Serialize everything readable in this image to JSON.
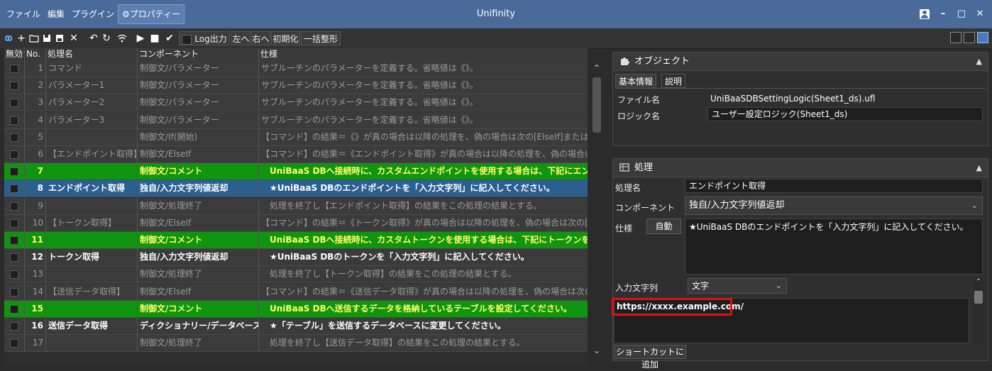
{
  "window": {
    "title": "Unifinity"
  },
  "menu": [
    {
      "label": "ファイル"
    },
    {
      "label": "編集"
    },
    {
      "label": "プラグイン"
    },
    {
      "label": "⚙プロパティー",
      "active": true
    }
  ],
  "toolbar": {
    "log_output": "Log出力",
    "left": "左へ",
    "right": "右へ",
    "init": "初期化",
    "format_all": "一括整形"
  },
  "grid": {
    "headers": {
      "disabled": "無効",
      "no": "No.",
      "name": "処理名",
      "component": "コンポーネント",
      "spec": "仕様"
    },
    "rows": [
      {
        "no": "1",
        "name": "コマンド",
        "component": "制御文/パラメーター",
        "spec": "サブルーチンのパラメーターを定義する。省略値は《》。",
        "style": "dim"
      },
      {
        "no": "2",
        "name": "パラメーター1",
        "component": "制御文/パラメーター",
        "spec": "サブルーチンのパラメーターを定義する。省略値は《》。",
        "style": "dim"
      },
      {
        "no": "3",
        "name": "パラメーター2",
        "component": "制御文/パラメーター",
        "spec": "サブルーチンのパラメーターを定義する。省略値は《》。",
        "style": "dim"
      },
      {
        "no": "4",
        "name": "パラメーター3",
        "component": "制御文/パラメーター",
        "spec": "サブルーチンのパラメーターを定義する。省略値は《》。",
        "style": "dim"
      },
      {
        "no": "5",
        "name": "",
        "component": "制御文/If(開始)",
        "spec": "【コマンド】の結果＝《》が真の場合は以降の処理を、偽の場合は次の[ElseIf]または[Else]ま",
        "style": "dim"
      },
      {
        "no": "6",
        "name": "【エンドポイント取得】",
        "component": "制御文/ElseIf",
        "spec": "【コマンド】の結果＝《エンドポイント取得》が真の場合は以降の処理を、偽の場合は次の[E",
        "style": "dim"
      },
      {
        "no": "7",
        "name": "",
        "component": "制御文/コメント",
        "spec": "　UniBaaS DBへ接続時に、カスタムエンドポイントを使用する場合は、下記にエンドポイン",
        "style": "green"
      },
      {
        "no": "8",
        "name": "エンドポイント取得",
        "component": "独自/入力文字列値返却",
        "spec": "　★UniBaaS DBのエンドポイントを「入力文字列」に記入してください。",
        "style": "blue"
      },
      {
        "no": "9",
        "name": "",
        "component": "制御文/処理終了",
        "spec": "　処理を終了し【エンドポイント取得】の結果をこの処理の結果とする。",
        "style": "dim"
      },
      {
        "no": "10",
        "name": "【トークン取得】",
        "component": "制御文/ElseIf",
        "spec": "【コマンド】の結果＝《トークン取得》が真の場合は以降の処理を、偽の場合は次の[ElseIf]ま",
        "style": "dim"
      },
      {
        "no": "11",
        "name": "",
        "component": "制御文/コメント",
        "spec": "　UniBaaS DBへ接続時に、カスタムトークンを使用する場合は、下記にトークンを設定して",
        "style": "green"
      },
      {
        "no": "12",
        "name": "トークン取得",
        "component": "独自/入力文字列値返却",
        "spec": "　★UniBaaS DBのトークンを「入力文字列」に記入してください。",
        "style": "bright"
      },
      {
        "no": "13",
        "name": "",
        "component": "制御文/処理終了",
        "spec": "　処理を終了し【トークン取得】の結果をこの処理の結果とする。",
        "style": "dim"
      },
      {
        "no": "14",
        "name": "【送信データ取得】",
        "component": "制御文/ElseIf",
        "spec": "【コマンド】の結果＝《送信データ取得》が真の場合は以降の処理を、偽の場合は次の[Else",
        "style": "dim"
      },
      {
        "no": "15",
        "name": "",
        "component": "制御文/コメント",
        "spec": "　UniBaaS DBへ送信するデータを格納しているテーブルを設定してください。",
        "style": "green"
      },
      {
        "no": "16",
        "name": "送信データ取得",
        "component": "ディクショナリー/データベース読込",
        "spec": "　★「テーブル」を送信するデータベースに変更してください。",
        "style": "bright"
      },
      {
        "no": "17",
        "name": "",
        "component": "制御文/処理終了",
        "spec": "　処理を終了し【送信データ取得】の結果をこの処理の結果とする。",
        "style": "dim"
      }
    ]
  },
  "object_panel": {
    "title": "オブジェクト",
    "tabs": [
      "基本情報",
      "説明"
    ],
    "file_label": "ファイル名",
    "file_value": "UniBaaSDBSettingLogic(Sheet1_ds).ufl",
    "logic_label": "ロジック名",
    "logic_value": "ユーザー設定ロジック(Sheet1_ds)"
  },
  "process_panel": {
    "title": "処理",
    "name_label": "処理名",
    "name_value": "エンドポイント取得",
    "component_label": "コンポーネント",
    "component_value": "独自/入力文字列値返却",
    "spec_label": "仕様",
    "auto_button": "自動",
    "spec_value": "★UniBaaS DBのエンドポイントを「入力文字列」に記入してください。",
    "input_label": "入力文字列",
    "input_type": "文字",
    "input_value": "https://xxxx.example.com/",
    "shortcut_button": "ショートカットに追加"
  },
  "highlight_color": "#e01010"
}
